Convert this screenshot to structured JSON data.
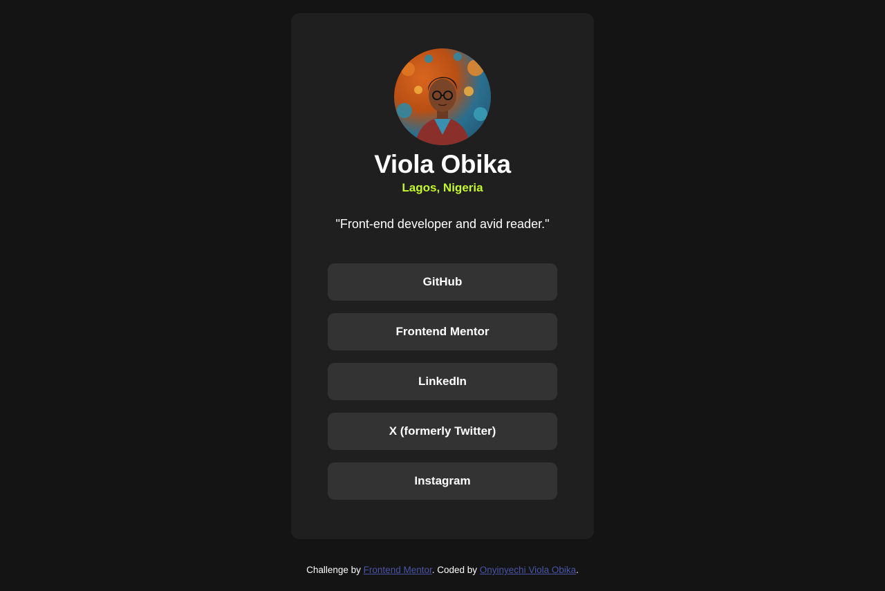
{
  "profile": {
    "name": "Viola Obika",
    "location": "Lagos, Nigeria",
    "bio": "\"Front-end developer and avid reader.\"",
    "avatar_alt": "Viola Obika"
  },
  "links": [
    {
      "label": "GitHub"
    },
    {
      "label": "Frontend Mentor"
    },
    {
      "label": "LinkedIn"
    },
    {
      "label": "X (formerly Twitter)"
    },
    {
      "label": "Instagram"
    }
  ],
  "footer": {
    "prefix": "Challenge by ",
    "challenge_link": "Frontend Mentor",
    "middle": ". Coded by ",
    "author_link": "Onyinyechi Viola Obika",
    "suffix": "."
  },
  "colors": {
    "background": "#141414",
    "card": "#1f1f1f",
    "button": "#333333",
    "accent": "#c4f82a",
    "footer_link": "#4a55a8"
  }
}
